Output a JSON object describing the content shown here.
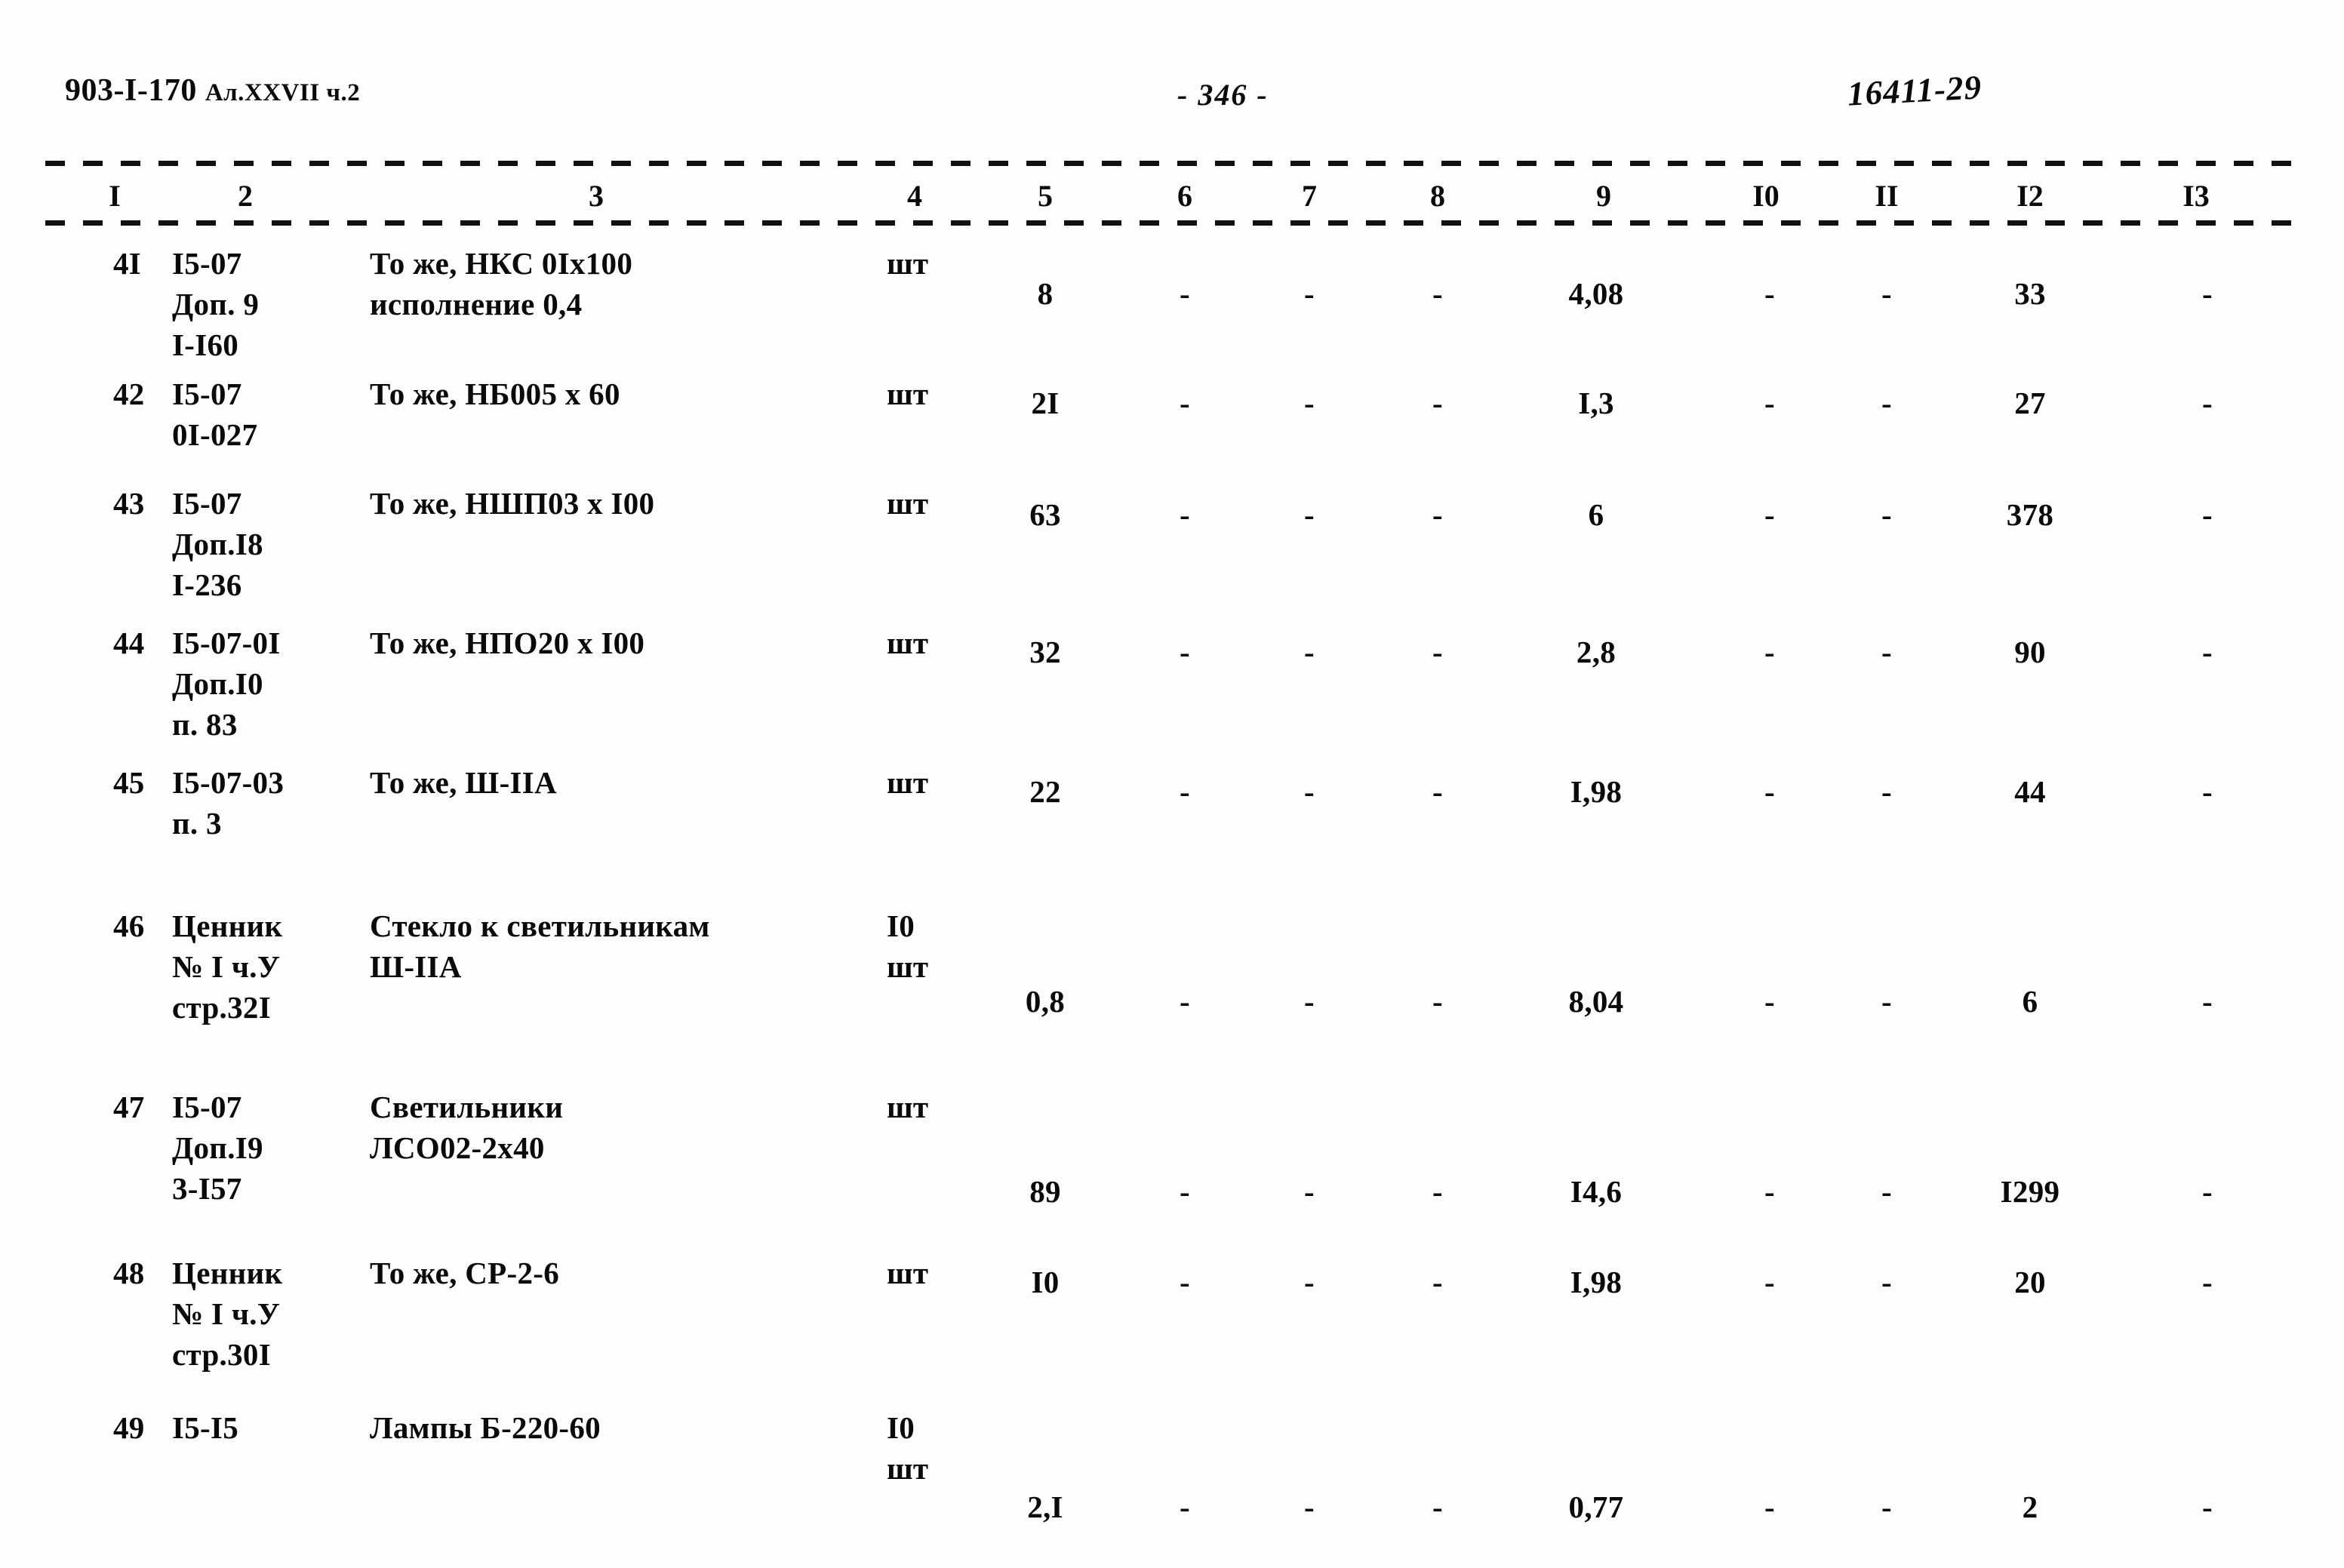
{
  "header": {
    "left_code": "903-I-170",
    "left_album": "Ал.XXVII",
    "left_part": "ч.2",
    "page_number": "- 346 -",
    "doc_number": "16411-29"
  },
  "table": {
    "column_headers": [
      "I",
      "2",
      "3",
      "4",
      "5",
      "6",
      "7",
      "8",
      "9",
      "I0",
      "II",
      "I2",
      "I3"
    ],
    "rows": [
      {
        "c1": "4I",
        "c2": [
          "I5-07",
          "Доп. 9",
          "I-I60"
        ],
        "c3": [
          "То же, НКС 0Iх100",
          "исполнение 0,4"
        ],
        "c4": [
          "шт"
        ],
        "c5": "8",
        "c6": "-",
        "c7": "-",
        "c8": "-",
        "c9": "4,08",
        "c10": "-",
        "c11": "-",
        "c12": "33",
        "c13": "-"
      },
      {
        "c1": "42",
        "c2": [
          "I5-07",
          "0I-027"
        ],
        "c3": [
          "То же, НБ005 х 60"
        ],
        "c4": [
          "шт"
        ],
        "c5": "2I",
        "c6": "-",
        "c7": "-",
        "c8": "-",
        "c9": "I,3",
        "c10": "-",
        "c11": "-",
        "c12": "27",
        "c13": "-"
      },
      {
        "c1": "43",
        "c2": [
          "I5-07",
          "Доп.I8",
          "I-236"
        ],
        "c3": [
          "То же, НШП03 х I00"
        ],
        "c4": [
          "шт"
        ],
        "c5": "63",
        "c6": "-",
        "c7": "-",
        "c8": "-",
        "c9": "6",
        "c10": "-",
        "c11": "-",
        "c12": "378",
        "c13": "-"
      },
      {
        "c1": "44",
        "c2": [
          "I5-07-0I",
          "Доп.I0",
          "п. 83"
        ],
        "c3": [
          "То же, НПО20 х I00"
        ],
        "c4": [
          "шт"
        ],
        "c5": "32",
        "c6": "-",
        "c7": "-",
        "c8": "-",
        "c9": "2,8",
        "c10": "-",
        "c11": "-",
        "c12": "90",
        "c13": "-"
      },
      {
        "c1": "45",
        "c2": [
          "I5-07-03",
          "п. 3"
        ],
        "c3": [
          "То же, Ш-IIА"
        ],
        "c4": [
          "шт"
        ],
        "c5": "22",
        "c6": "-",
        "c7": "-",
        "c8": "-",
        "c9": "I,98",
        "c10": "-",
        "c11": "-",
        "c12": "44",
        "c13": "-"
      },
      {
        "c1": "46",
        "c2": [
          "Ценник",
          "№ I ч.У",
          "стр.32I"
        ],
        "c3": [
          "Стекло к светильникам",
          "Ш-IIА"
        ],
        "c4": [
          "I0",
          "шт"
        ],
        "c5": "0,8",
        "c6": "-",
        "c7": "-",
        "c8": "-",
        "c9": "8,04",
        "c10": "-",
        "c11": "-",
        "c12": "6",
        "c13": "-"
      },
      {
        "c1": "47",
        "c2": [
          "I5-07",
          "Доп.I9",
          "3-I57"
        ],
        "c3": [
          "Светильники",
          "ЛСО02-2х40"
        ],
        "c4": [
          "шт"
        ],
        "c5": "89",
        "c6": "-",
        "c7": "-",
        "c8": "-",
        "c9": "I4,6",
        "c10": "-",
        "c11": "-",
        "c12": "I299",
        "c13": "-"
      },
      {
        "c1": "48",
        "c2": [
          "Ценник",
          "№ I ч.У",
          "стр.30I"
        ],
        "c3": [
          "То же, СР-2-6"
        ],
        "c4": [
          "шт"
        ],
        "c5": "I0",
        "c6": "-",
        "c7": "-",
        "c8": "-",
        "c9": "I,98",
        "c10": "-",
        "c11": "-",
        "c12": "20",
        "c13": "-"
      },
      {
        "c1": "49",
        "c2": [
          "I5-I5"
        ],
        "c3": [
          "Лампы Б-220-60"
        ],
        "c4": [
          "I0",
          "шт"
        ],
        "c5": "2,I",
        "c6": "-",
        "c7": "-",
        "c8": "-",
        "c9": "0,77",
        "c10": "-",
        "c11": "-",
        "c12": "2",
        "c13": "-"
      }
    ]
  },
  "layout": {
    "col_x": {
      "c1": 150,
      "c2": 228,
      "c3": 490,
      "c4": 1175,
      "c5": 1385,
      "c6": 1570,
      "c7": 1735,
      "c8": 1905,
      "c9": 2115,
      "c10": 2345,
      "c11": 2500,
      "c12": 2690,
      "c13": 2925
    },
    "header_x": {
      "1": 152,
      "2": 325,
      "3": 790,
      "4": 1212,
      "5": 1385,
      "6": 1570,
      "7": 1735,
      "8": 1905,
      "9": 2125,
      "10": 2340,
      "11": 2500,
      "12": 2690,
      "13": 2910
    },
    "row_top": [
      12,
      185,
      330,
      515,
      700,
      890,
      1130,
      1350,
      1555
    ],
    "row_valign": [
      40,
      12,
      15,
      12,
      12,
      100,
      112,
      12,
      105
    ]
  }
}
